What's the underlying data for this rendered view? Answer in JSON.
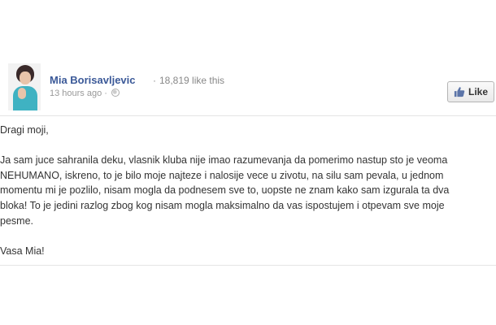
{
  "post": {
    "author": "Mia Borisavljevic",
    "likes_dot": "·",
    "likes_text": "18,819 like this",
    "timestamp": "13 hours ago ·",
    "like_button": "Like",
    "greeting": "Dragi moji,",
    "lines": [
      "Ja sam juce sahranila deku, vlasnik kluba nije imao razumevanja da pomerimo nastup sto je veoma",
      "NEHUMANO, iskreno, to je bilo moje najteze i nalosije vece u zivotu, na silu sam pevala, u jednom",
      "momentu mi je pozlilo, nisam mogla da podnesem sve to, uopste ne znam kako sam izgurala ta dva",
      "bloka! To je jedini razlog zbog kog nisam mogla maksimalno da vas ispostujem i otpevam sve moje",
      "pesme."
    ],
    "signoff": "Vasa Mia!"
  },
  "icons": {
    "avatar": "profile-photo",
    "privacy": "globe-icon",
    "like": "thumbs-up-icon"
  }
}
